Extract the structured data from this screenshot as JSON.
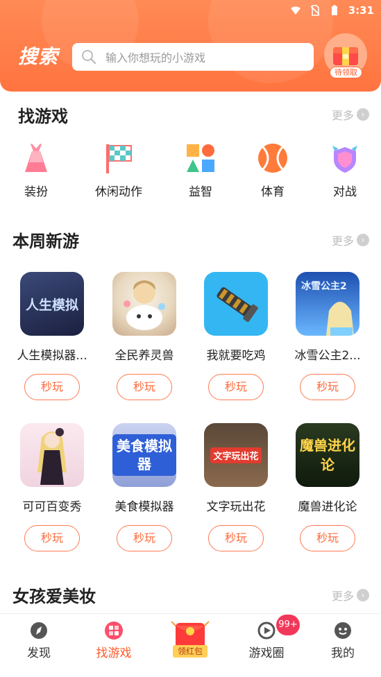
{
  "status_bar": {
    "time": "3:31"
  },
  "header": {
    "title": "搜索",
    "search_placeholder": "输入你想玩的小游戏",
    "gift_label": "待领取"
  },
  "find_games": {
    "title": "找游戏",
    "more": "更多",
    "categories": [
      {
        "label": "装扮",
        "icon": "dress-icon"
      },
      {
        "label": "休闲动作",
        "icon": "flag-icon"
      },
      {
        "label": "益智",
        "icon": "shapes-icon"
      },
      {
        "label": "体育",
        "icon": "ball-icon"
      },
      {
        "label": "对战",
        "icon": "shield-icon"
      }
    ]
  },
  "weekly_new": {
    "title": "本周新游",
    "more": "更多",
    "play_label": "秒玩",
    "games": [
      {
        "name": "人生模拟器...",
        "thumb_text": "人生模拟"
      },
      {
        "name": "全民养灵兽",
        "thumb_text": ""
      },
      {
        "name": "我就要吃鸡",
        "thumb_text": ""
      },
      {
        "name": "冰雪公主2...",
        "thumb_text": "冰雪公主2"
      },
      {
        "name": "可可百变秀",
        "thumb_text": ""
      },
      {
        "name": "美食模拟器",
        "thumb_text": "美食模拟器"
      },
      {
        "name": "文字玩出花",
        "thumb_text": "文字玩出花"
      },
      {
        "name": "魔兽进化论",
        "thumb_text": "魔兽进化论"
      }
    ]
  },
  "girls_makeup": {
    "title": "女孩爱美妆",
    "more": "更多"
  },
  "bottom_nav": {
    "items": [
      {
        "label": "发现"
      },
      {
        "label": "找游戏"
      },
      {
        "label": "游戏圈"
      },
      {
        "label": "我的"
      }
    ],
    "red_packet_label": "领红包",
    "badge": "99+"
  },
  "colors": {
    "accent": "#ff6a3a",
    "header": "#ff7a48",
    "badge": "#f2385a"
  }
}
